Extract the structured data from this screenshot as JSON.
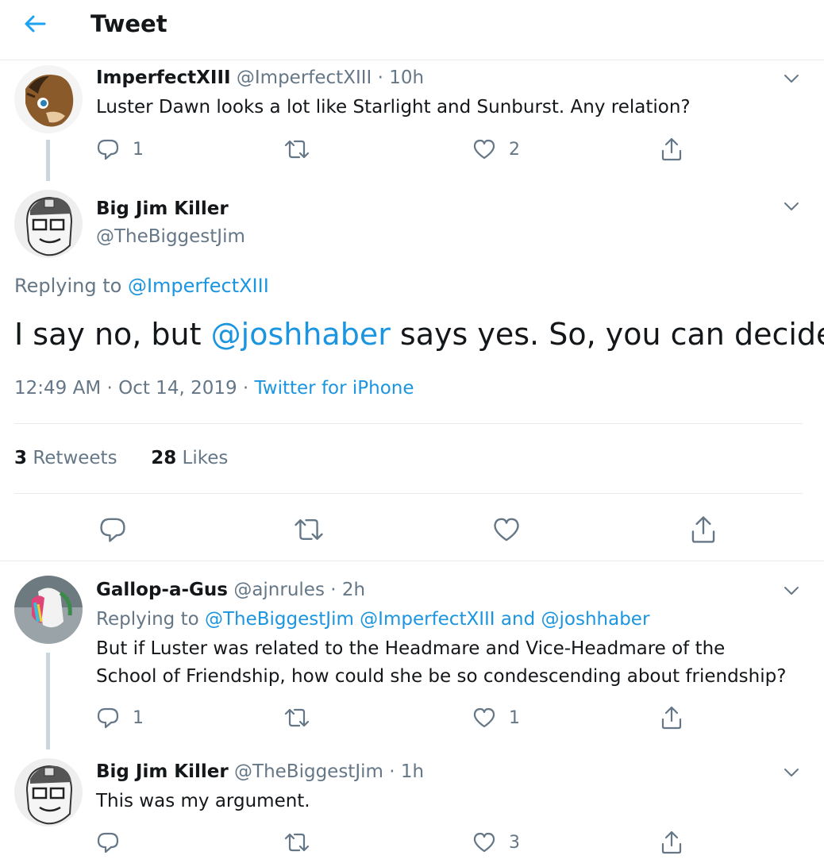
{
  "header": {
    "title": "Tweet"
  },
  "tweets": [
    {
      "name": "ImperfectXIII",
      "handle": "@ImperfectXIII",
      "time": "10h",
      "text": "Luster Dawn looks a lot like Starlight and Sunburst. Any relation?",
      "replies": "1",
      "retweets": "",
      "likes": "2"
    },
    {
      "name": "Gallop-a-Gus",
      "handle": "@ajnrules",
      "time": "2h",
      "replying_label": "Replying to",
      "replying_to": "@TheBiggestJim @ImperfectXIII",
      "replying_and": "and",
      "replying_last": "@joshhaber",
      "text_line1": "But if Luster was related to the Headmare and Vice-Headmare of the",
      "text_line2": "School of Friendship, how could she be so condescending about friendship?",
      "replies": "1",
      "retweets": "",
      "likes": "1"
    },
    {
      "name": "Big Jim Killer",
      "handle": "@TheBiggestJim",
      "time": "1h",
      "text": "This was my argument.",
      "replies": "",
      "retweets": "",
      "likes": "3"
    }
  ],
  "main_tweet": {
    "name": "Big Jim Killer",
    "handle": "@TheBiggestJim",
    "replying_label": "Replying to",
    "replying_to": "@ImperfectXIII",
    "text_before": "I say no, but",
    "text_mention": "@joshhaber",
    "text_after": "says yes. So, you can decide!",
    "timestamp": "12:49 AM · Oct 14, 2019",
    "source": "Twitter for iPhone",
    "retweets_count": "3",
    "retweets_label": "Retweets",
    "likes_count": "28",
    "likes_label": "Likes"
  },
  "separator": "·",
  "colors": {
    "accent": "#1b95e0",
    "secondary_text": "#657786",
    "border": "#e6ecf0",
    "thread_line": "#ccd6dd"
  }
}
